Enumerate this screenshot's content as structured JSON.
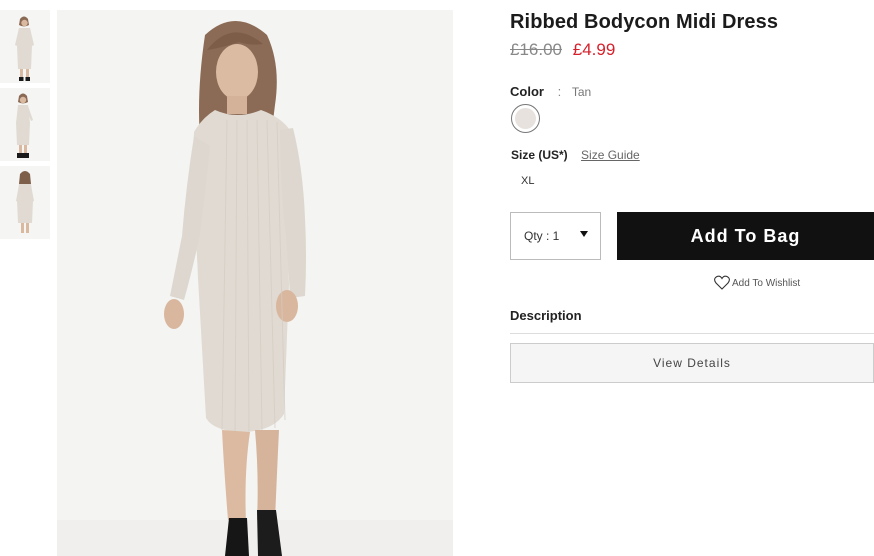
{
  "thumbnails": [
    {
      "alt": "",
      "icon": "dress-front-thumbnail"
    },
    {
      "alt": "",
      "icon": "dress-side-thumbnail"
    },
    {
      "alt": "",
      "icon": "dress-back-thumbnail"
    }
  ],
  "product": {
    "title": "Ribbed Bodycon Midi Dress",
    "price_old": "£16.00",
    "price_new": "£4.99"
  },
  "color": {
    "label": "Color",
    "separator": ":",
    "value": "Tan",
    "swatch_hex": "#e7e2dd"
  },
  "size": {
    "label": "Size (US*)",
    "guide_link": "Size Guide",
    "options": [
      "XL"
    ]
  },
  "quantity": {
    "text": "Qty : 1"
  },
  "actions": {
    "add_to_bag": "Add To Bag",
    "wishlist": "Add To Wishlist"
  },
  "description": {
    "label": "Description",
    "view_details": "View Details"
  },
  "colors": {
    "price_sale": "#d6202b",
    "button_bg": "#111111",
    "dress": "#e0dad2"
  }
}
